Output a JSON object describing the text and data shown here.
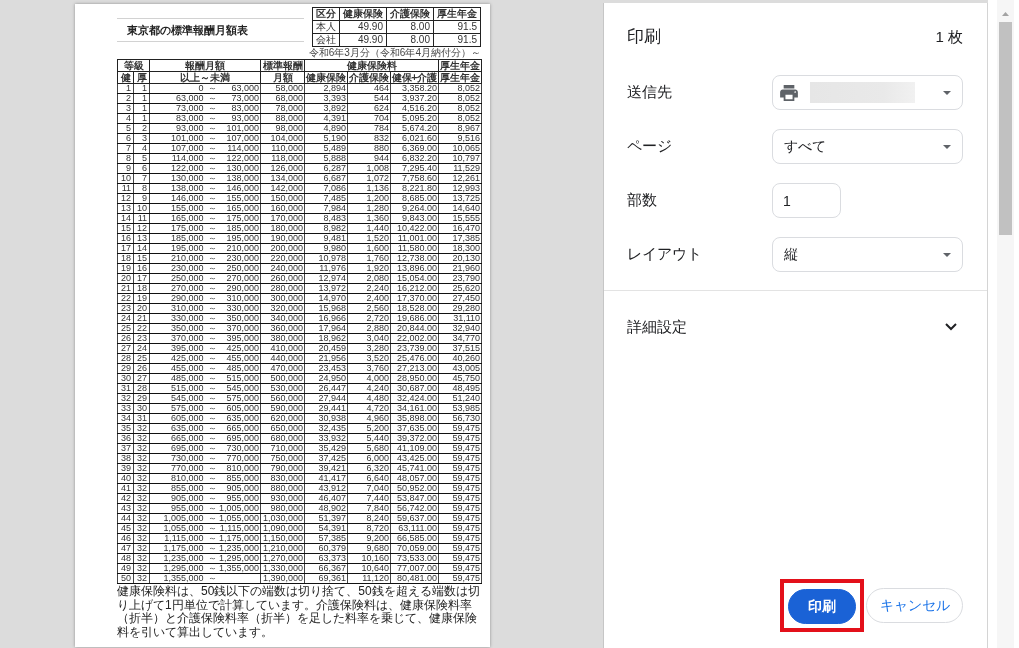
{
  "preview": {
    "title": "東京都の標準報酬月額表",
    "rate_table": {
      "columns": [
        "区分",
        "健康保険",
        "介護保険",
        "厚生年金"
      ],
      "rows": [
        [
          "本人",
          "49.90",
          "8.00",
          "91.5"
        ],
        [
          "会社",
          "49.90",
          "8.00",
          "91.5"
        ]
      ]
    },
    "caption": "令和6年3月分（令和6年4月納付分）～",
    "table": {
      "header": [
        {
          "label": "等級",
          "subheaders": [
            "健",
            "厚"
          ]
        },
        {
          "label": "報酬月額",
          "subheaders": [
            "以上～未満"
          ]
        },
        {
          "label": "標準報酬",
          "subheaders": [
            "月額"
          ]
        },
        {
          "label": "健康保険料",
          "subheaders": [
            "健康保険",
            "介護保険",
            "健保+介護"
          ]
        },
        {
          "label": "厚生年金",
          "subheaders": [
            "厚生年金"
          ]
        }
      ],
      "rows": [
        {
          "kenpo_grade": "1",
          "kosei_grade": "1",
          "from": "0",
          "tilde": "～",
          "to": "63,000",
          "standard": "58,000",
          "health": "2,894",
          "care": "464",
          "total": "3,358.20",
          "pension": "8,052"
        },
        {
          "kenpo_grade": "2",
          "kosei_grade": "1",
          "from": "63,000",
          "tilde": "～",
          "to": "73,000",
          "standard": "68,000",
          "health": "3,393",
          "care": "544",
          "total": "3,937.20",
          "pension": "8,052"
        },
        {
          "kenpo_grade": "3",
          "kosei_grade": "1",
          "from": "73,000",
          "tilde": "～",
          "to": "83,000",
          "standard": "78,000",
          "health": "3,892",
          "care": "624",
          "total": "4,516.20",
          "pension": "8,052"
        },
        {
          "kenpo_grade": "4",
          "kosei_grade": "1",
          "from": "83,000",
          "tilde": "～",
          "to": "93,000",
          "standard": "88,000",
          "health": "4,391",
          "care": "704",
          "total": "5,095.20",
          "pension": "8,052"
        },
        {
          "kenpo_grade": "5",
          "kosei_grade": "2",
          "from": "93,000",
          "tilde": "～",
          "to": "101,000",
          "standard": "98,000",
          "health": "4,890",
          "care": "784",
          "total": "5,674.20",
          "pension": "8,967"
        },
        {
          "kenpo_grade": "6",
          "kosei_grade": "3",
          "from": "101,000",
          "tilde": "～",
          "to": "107,000",
          "standard": "104,000",
          "health": "5,190",
          "care": "832",
          "total": "6,021.60",
          "pension": "9,516"
        },
        {
          "kenpo_grade": "7",
          "kosei_grade": "4",
          "from": "107,000",
          "tilde": "～",
          "to": "114,000",
          "standard": "110,000",
          "health": "5,489",
          "care": "880",
          "total": "6,369.00",
          "pension": "10,065"
        },
        {
          "kenpo_grade": "8",
          "kosei_grade": "5",
          "from": "114,000",
          "tilde": "～",
          "to": "122,000",
          "standard": "118,000",
          "health": "5,888",
          "care": "944",
          "total": "6,832.20",
          "pension": "10,797"
        },
        {
          "kenpo_grade": "9",
          "kosei_grade": "6",
          "from": "122,000",
          "tilde": "～",
          "to": "130,000",
          "standard": "126,000",
          "health": "6,287",
          "care": "1,008",
          "total": "7,295.40",
          "pension": "11,529"
        },
        {
          "kenpo_grade": "10",
          "kosei_grade": "7",
          "from": "130,000",
          "tilde": "～",
          "to": "138,000",
          "standard": "134,000",
          "health": "6,687",
          "care": "1,072",
          "total": "7,758.60",
          "pension": "12,261"
        },
        {
          "kenpo_grade": "11",
          "kosei_grade": "8",
          "from": "138,000",
          "tilde": "～",
          "to": "146,000",
          "standard": "142,000",
          "health": "7,086",
          "care": "1,136",
          "total": "8,221.80",
          "pension": "12,993"
        },
        {
          "kenpo_grade": "12",
          "kosei_grade": "9",
          "from": "146,000",
          "tilde": "～",
          "to": "155,000",
          "standard": "150,000",
          "health": "7,485",
          "care": "1,200",
          "total": "8,685.00",
          "pension": "13,725"
        },
        {
          "kenpo_grade": "13",
          "kosei_grade": "10",
          "from": "155,000",
          "tilde": "～",
          "to": "165,000",
          "standard": "160,000",
          "health": "7,984",
          "care": "1,280",
          "total": "9,264.00",
          "pension": "14,640"
        },
        {
          "kenpo_grade": "14",
          "kosei_grade": "11",
          "from": "165,000",
          "tilde": "～",
          "to": "175,000",
          "standard": "170,000",
          "health": "8,483",
          "care": "1,360",
          "total": "9,843.00",
          "pension": "15,555"
        },
        {
          "kenpo_grade": "15",
          "kosei_grade": "12",
          "from": "175,000",
          "tilde": "～",
          "to": "185,000",
          "standard": "180,000",
          "health": "8,982",
          "care": "1,440",
          "total": "10,422.00",
          "pension": "16,470"
        },
        {
          "kenpo_grade": "16",
          "kosei_grade": "13",
          "from": "185,000",
          "tilde": "～",
          "to": "195,000",
          "standard": "190,000",
          "health": "9,481",
          "care": "1,520",
          "total": "11,001.00",
          "pension": "17,385"
        },
        {
          "kenpo_grade": "17",
          "kosei_grade": "14",
          "from": "195,000",
          "tilde": "～",
          "to": "210,000",
          "standard": "200,000",
          "health": "9,980",
          "care": "1,600",
          "total": "11,580.00",
          "pension": "18,300"
        },
        {
          "kenpo_grade": "18",
          "kosei_grade": "15",
          "from": "210,000",
          "tilde": "～",
          "to": "230,000",
          "standard": "220,000",
          "health": "10,978",
          "care": "1,760",
          "total": "12,738.00",
          "pension": "20,130"
        },
        {
          "kenpo_grade": "19",
          "kosei_grade": "16",
          "from": "230,000",
          "tilde": "～",
          "to": "250,000",
          "standard": "240,000",
          "health": "11,976",
          "care": "1,920",
          "total": "13,896.00",
          "pension": "21,960"
        },
        {
          "kenpo_grade": "20",
          "kosei_grade": "17",
          "from": "250,000",
          "tilde": "～",
          "to": "270,000",
          "standard": "260,000",
          "health": "12,974",
          "care": "2,080",
          "total": "15,054.00",
          "pension": "23,790"
        },
        {
          "kenpo_grade": "21",
          "kosei_grade": "18",
          "from": "270,000",
          "tilde": "～",
          "to": "290,000",
          "standard": "280,000",
          "health": "13,972",
          "care": "2,240",
          "total": "16,212.00",
          "pension": "25,620"
        },
        {
          "kenpo_grade": "22",
          "kosei_grade": "19",
          "from": "290,000",
          "tilde": "～",
          "to": "310,000",
          "standard": "300,000",
          "health": "14,970",
          "care": "2,400",
          "total": "17,370.00",
          "pension": "27,450"
        },
        {
          "kenpo_grade": "23",
          "kosei_grade": "20",
          "from": "310,000",
          "tilde": "～",
          "to": "330,000",
          "standard": "320,000",
          "health": "15,968",
          "care": "2,560",
          "total": "18,528.00",
          "pension": "29,280"
        },
        {
          "kenpo_grade": "24",
          "kosei_grade": "21",
          "from": "330,000",
          "tilde": "～",
          "to": "350,000",
          "standard": "340,000",
          "health": "16,966",
          "care": "2,720",
          "total": "19,686.00",
          "pension": "31,110"
        },
        {
          "kenpo_grade": "25",
          "kosei_grade": "22",
          "from": "350,000",
          "tilde": "～",
          "to": "370,000",
          "standard": "360,000",
          "health": "17,964",
          "care": "2,880",
          "total": "20,844.00",
          "pension": "32,940"
        },
        {
          "kenpo_grade": "26",
          "kosei_grade": "23",
          "from": "370,000",
          "tilde": "～",
          "to": "395,000",
          "standard": "380,000",
          "health": "18,962",
          "care": "3,040",
          "total": "22,002.00",
          "pension": "34,770"
        },
        {
          "kenpo_grade": "27",
          "kosei_grade": "24",
          "from": "395,000",
          "tilde": "～",
          "to": "425,000",
          "standard": "410,000",
          "health": "20,459",
          "care": "3,280",
          "total": "23,739.00",
          "pension": "37,515"
        },
        {
          "kenpo_grade": "28",
          "kosei_grade": "25",
          "from": "425,000",
          "tilde": "～",
          "to": "455,000",
          "standard": "440,000",
          "health": "21,956",
          "care": "3,520",
          "total": "25,476.00",
          "pension": "40,260"
        },
        {
          "kenpo_grade": "29",
          "kosei_grade": "26",
          "from": "455,000",
          "tilde": "～",
          "to": "485,000",
          "standard": "470,000",
          "health": "23,453",
          "care": "3,760",
          "total": "27,213.00",
          "pension": "43,005"
        },
        {
          "kenpo_grade": "30",
          "kosei_grade": "27",
          "from": "485,000",
          "tilde": "～",
          "to": "515,000",
          "standard": "500,000",
          "health": "24,950",
          "care": "4,000",
          "total": "28,950.00",
          "pension": "45,750"
        },
        {
          "kenpo_grade": "31",
          "kosei_grade": "28",
          "from": "515,000",
          "tilde": "～",
          "to": "545,000",
          "standard": "530,000",
          "health": "26,447",
          "care": "4,240",
          "total": "30,687.00",
          "pension": "48,495"
        },
        {
          "kenpo_grade": "32",
          "kosei_grade": "29",
          "from": "545,000",
          "tilde": "～",
          "to": "575,000",
          "standard": "560,000",
          "health": "27,944",
          "care": "4,480",
          "total": "32,424.00",
          "pension": "51,240"
        },
        {
          "kenpo_grade": "33",
          "kosei_grade": "30",
          "from": "575,000",
          "tilde": "～",
          "to": "605,000",
          "standard": "590,000",
          "health": "29,441",
          "care": "4,720",
          "total": "34,161.00",
          "pension": "53,985"
        },
        {
          "kenpo_grade": "34",
          "kosei_grade": "31",
          "from": "605,000",
          "tilde": "～",
          "to": "635,000",
          "standard": "620,000",
          "health": "30,938",
          "care": "4,960",
          "total": "35,898.00",
          "pension": "56,730"
        },
        {
          "kenpo_grade": "35",
          "kosei_grade": "32",
          "from": "635,000",
          "tilde": "～",
          "to": "665,000",
          "standard": "650,000",
          "health": "32,435",
          "care": "5,200",
          "total": "37,635.00",
          "pension": "59,475"
        },
        {
          "kenpo_grade": "36",
          "kosei_grade": "32",
          "from": "665,000",
          "tilde": "～",
          "to": "695,000",
          "standard": "680,000",
          "health": "33,932",
          "care": "5,440",
          "total": "39,372.00",
          "pension": "59,475"
        },
        {
          "kenpo_grade": "37",
          "kosei_grade": "32",
          "from": "695,000",
          "tilde": "～",
          "to": "730,000",
          "standard": "710,000",
          "health": "35,429",
          "care": "5,680",
          "total": "41,109.00",
          "pension": "59,475"
        },
        {
          "kenpo_grade": "38",
          "kosei_grade": "32",
          "from": "730,000",
          "tilde": "～",
          "to": "770,000",
          "standard": "750,000",
          "health": "37,425",
          "care": "6,000",
          "total": "43,425.00",
          "pension": "59,475"
        },
        {
          "kenpo_grade": "39",
          "kosei_grade": "32",
          "from": "770,000",
          "tilde": "～",
          "to": "810,000",
          "standard": "790,000",
          "health": "39,421",
          "care": "6,320",
          "total": "45,741.00",
          "pension": "59,475"
        },
        {
          "kenpo_grade": "40",
          "kosei_grade": "32",
          "from": "810,000",
          "tilde": "～",
          "to": "855,000",
          "standard": "830,000",
          "health": "41,417",
          "care": "6,640",
          "total": "48,057.00",
          "pension": "59,475"
        },
        {
          "kenpo_grade": "41",
          "kosei_grade": "32",
          "from": "855,000",
          "tilde": "～",
          "to": "905,000",
          "standard": "880,000",
          "health": "43,912",
          "care": "7,040",
          "total": "50,952.00",
          "pension": "59,475"
        },
        {
          "kenpo_grade": "42",
          "kosei_grade": "32",
          "from": "905,000",
          "tilde": "～",
          "to": "955,000",
          "standard": "930,000",
          "health": "46,407",
          "care": "7,440",
          "total": "53,847.00",
          "pension": "59,475"
        },
        {
          "kenpo_grade": "43",
          "kosei_grade": "32",
          "from": "955,000",
          "tilde": "～",
          "to": "1,005,000",
          "standard": "980,000",
          "health": "48,902",
          "care": "7,840",
          "total": "56,742.00",
          "pension": "59,475"
        },
        {
          "kenpo_grade": "44",
          "kosei_grade": "32",
          "from": "1,005,000",
          "tilde": "～",
          "to": "1,055,000",
          "standard": "1,030,000",
          "health": "51,397",
          "care": "8,240",
          "total": "59,637.00",
          "pension": "59,475"
        },
        {
          "kenpo_grade": "45",
          "kosei_grade": "32",
          "from": "1,055,000",
          "tilde": "～",
          "to": "1,115,000",
          "standard": "1,090,000",
          "health": "54,391",
          "care": "8,720",
          "total": "63,111.00",
          "pension": "59,475"
        },
        {
          "kenpo_grade": "46",
          "kosei_grade": "32",
          "from": "1,115,000",
          "tilde": "～",
          "to": "1,175,000",
          "standard": "1,150,000",
          "health": "57,385",
          "care": "9,200",
          "total": "66,585.00",
          "pension": "59,475"
        },
        {
          "kenpo_grade": "47",
          "kosei_grade": "32",
          "from": "1,175,000",
          "tilde": "～",
          "to": "1,235,000",
          "standard": "1,210,000",
          "health": "60,379",
          "care": "9,680",
          "total": "70,059.00",
          "pension": "59,475"
        },
        {
          "kenpo_grade": "48",
          "kosei_grade": "32",
          "from": "1,235,000",
          "tilde": "～",
          "to": "1,295,000",
          "standard": "1,270,000",
          "health": "63,373",
          "care": "10,160",
          "total": "73,533.00",
          "pension": "59,475"
        },
        {
          "kenpo_grade": "49",
          "kosei_grade": "32",
          "from": "1,295,000",
          "tilde": "～",
          "to": "1,355,000",
          "standard": "1,330,000",
          "health": "66,367",
          "care": "10,640",
          "total": "77,007.00",
          "pension": "59,475"
        },
        {
          "kenpo_grade": "50",
          "kosei_grade": "32",
          "from": "1,355,000",
          "tilde": "～",
          "standard": "1,390,000",
          "health": "69,361",
          "care": "11,120",
          "total": "80,481.00",
          "pension": "59,475"
        }
      ]
    },
    "footnote": "健康保険料は、50銭以下の端数は切り捨て、50銭を超える端数は切り上げて1円単位で計算しています。介護保険料は、健康保険料率（折半）と介護保険料率（折半）を足した料率を乗じて、健康保険料を引いて算出しています。"
  },
  "panel": {
    "title": "印刷",
    "sheet_count": "1 枚",
    "settings": [
      {
        "kind": "printer-select",
        "label": "送信先"
      },
      {
        "kind": "select",
        "label": "ページ",
        "value": "すべて"
      },
      {
        "kind": "number",
        "label": "部数",
        "value": "1"
      },
      {
        "kind": "select",
        "label": "レイアウト",
        "value": "縦"
      }
    ],
    "more_settings": {
      "label": "詳細設定",
      "expanded": false
    },
    "buttons": [
      {
        "kind": "primary",
        "label": "印刷",
        "highlighted": true
      },
      {
        "kind": "secondary",
        "label": "キャンセル",
        "highlighted": false
      }
    ]
  }
}
